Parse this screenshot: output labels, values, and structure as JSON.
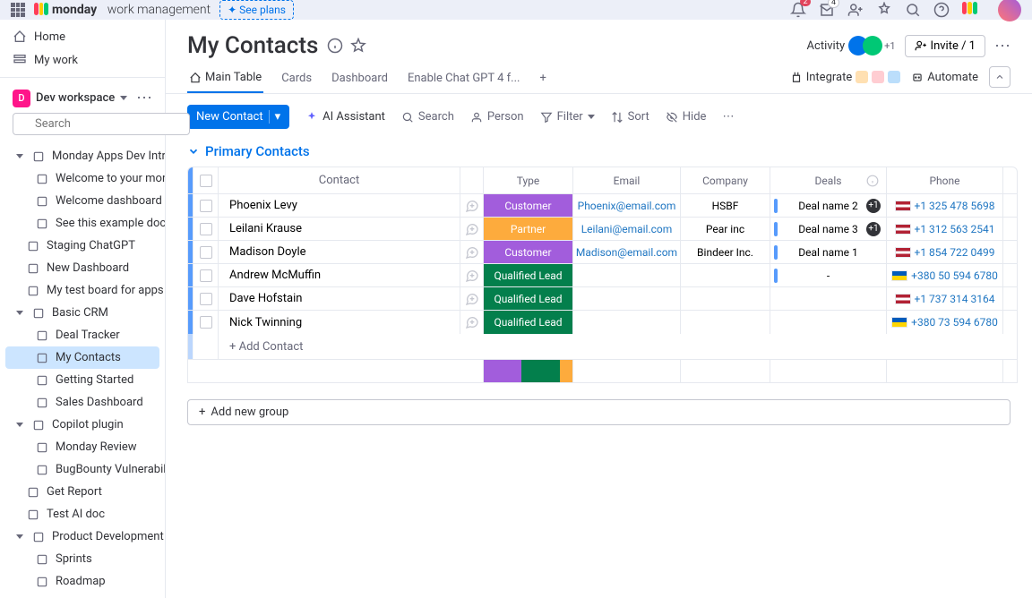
{
  "topbar": {
    "brand_bold": "monday",
    "brand_light": "work management",
    "see_plans": "See plans",
    "notif_badge": "2",
    "inbox_badge": "4"
  },
  "sidebar": {
    "home": "Home",
    "mywork": "My work",
    "workspace": "Dev workspace",
    "workspace_initial": "D",
    "search_placeholder": "Search",
    "groups": [
      {
        "label": "Monday Apps Dev Intro",
        "children": [
          {
            "label": "Welcome to your mond..."
          },
          {
            "label": "Welcome dashboard"
          },
          {
            "label": "See this example doc 👇"
          }
        ]
      },
      {
        "label": "Staging ChatGPT"
      },
      {
        "label": "New Dashboard"
      },
      {
        "label": "My test board for apps"
      },
      {
        "label": "Basic CRM",
        "children": [
          {
            "label": "Deal Tracker"
          },
          {
            "label": "My Contacts",
            "active": true
          },
          {
            "label": "Getting Started"
          },
          {
            "label": "Sales Dashboard"
          }
        ]
      },
      {
        "label": "Copilot plugin",
        "children": [
          {
            "label": "Monday Review"
          },
          {
            "label": "BugBounty Vulnerabiliti..."
          }
        ]
      },
      {
        "label": "Get Report"
      },
      {
        "label": "Test AI doc"
      },
      {
        "label": "Product Development",
        "children": [
          {
            "label": "Sprints"
          },
          {
            "label": "Roadmap"
          }
        ]
      }
    ]
  },
  "header": {
    "title": "My Contacts",
    "activity": "Activity",
    "plus1": "+1",
    "invite": "Invite / 1"
  },
  "tabs": {
    "main": "Main Table",
    "cards": "Cards",
    "dashboard": "Dashboard",
    "gpt": "Enable Chat GPT 4 f...",
    "integrate": "Integrate",
    "automate": "Automate"
  },
  "toolbar": {
    "new": "New Contact",
    "ai": "AI Assistant",
    "search": "Search",
    "person": "Person",
    "filter": "Filter",
    "sort": "Sort",
    "hide": "Hide"
  },
  "group": {
    "title": "Primary Contacts",
    "add_contact": "+ Add Contact",
    "add_group": "Add new group"
  },
  "columns": {
    "contact": "Contact",
    "type": "Type",
    "email": "Email",
    "company": "Company",
    "deals": "Deals",
    "phone": "Phone"
  },
  "rows": [
    {
      "contact": "Phoenix Levy",
      "type": "Customer",
      "type_class": "type-customer",
      "email": "Phoenix@email.com",
      "company": "HSBF",
      "deal": "Deal name 2",
      "deal_count": "+1",
      "flag": "us",
      "phone": "+1 325 478 5698"
    },
    {
      "contact": "Leilani Krause",
      "type": "Partner",
      "type_class": "type-partner",
      "email": "Leilani@email.com",
      "company": "Pear inc",
      "deal": "Deal name 3",
      "deal_count": "+1",
      "flag": "us",
      "phone": "+1 312 563 2541"
    },
    {
      "contact": "Madison Doyle",
      "type": "Customer",
      "type_class": "type-customer",
      "email": "Madison@email.com",
      "company": "Bindeer Inc.",
      "deal": "Deal name 1",
      "deal_count": "",
      "flag": "us",
      "phone": "+1 854 722 0499"
    },
    {
      "contact": "Andrew McMuffin",
      "type": "Qualified Lead",
      "type_class": "type-lead",
      "email": "",
      "company": "",
      "deal": "-",
      "deal_count": "",
      "flag": "ua",
      "phone": "+380 50 594 6780"
    },
    {
      "contact": "Dave Hofstain",
      "type": "Qualified Lead",
      "type_class": "type-lead",
      "email": "",
      "company": "",
      "deal": "",
      "deal_count": "",
      "flag": "us",
      "phone": "+1 737 314 3164"
    },
    {
      "contact": "Nick Twinning",
      "type": "Qualified Lead",
      "type_class": "type-lead",
      "email": "",
      "company": "",
      "deal": "",
      "deal_count": "",
      "flag": "ua",
      "phone": "+380 73 594 6780"
    }
  ]
}
